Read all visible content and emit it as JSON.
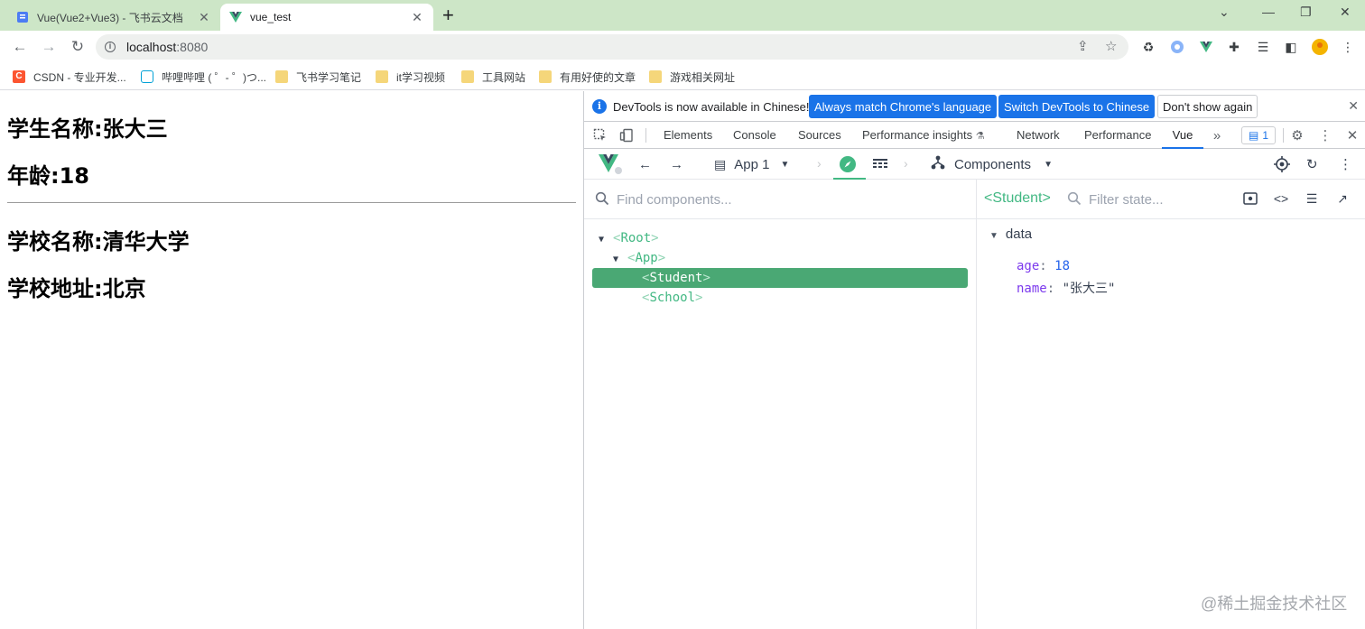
{
  "browser": {
    "tabs": [
      {
        "title": "Vue(Vue2+Vue3) - 飞书云文档",
        "icon": "doc-icon",
        "active": false
      },
      {
        "title": "vue_test",
        "icon": "vue-logo-icon",
        "active": true
      }
    ],
    "address": {
      "host": "localhost",
      "port": ":8080"
    },
    "bookmarks": [
      {
        "label": "CSDN - 专业开发...",
        "icon": "csdn-icon"
      },
      {
        "label": "哔哩哔哩 ( ゜- ゜)つ...",
        "icon": "bilibili-icon"
      },
      {
        "label": "飞书学习笔记",
        "icon": "folder-icon"
      },
      {
        "label": "it学习视频",
        "icon": "folder-icon"
      },
      {
        "label": "工具网站",
        "icon": "folder-icon"
      },
      {
        "label": "有用好使的文章",
        "icon": "folder-icon"
      },
      {
        "label": "游戏相关网址",
        "icon": "folder-icon"
      }
    ]
  },
  "page": {
    "student_name": "学生名称:张大三",
    "student_age": "年龄:18",
    "school_name": "学校名称:清华大学",
    "school_address": "学校地址:北京"
  },
  "devtools": {
    "infobar": {
      "message": "DevTools is now available in Chinese!",
      "match_button": "Always match Chrome's language",
      "switch_button": "Switch DevTools to Chinese",
      "dismiss_button": "Don't show again"
    },
    "tabs": [
      "Elements",
      "Console",
      "Sources",
      "Performance insights",
      "Network",
      "Performance",
      "Vue"
    ],
    "active_tab": "Vue",
    "issues_count": "1"
  },
  "vue": {
    "app_selector": "App 1",
    "view_selector": "Components",
    "find_placeholder": "Find components...",
    "filter_placeholder": "Filter state...",
    "selected_component": "<Student>",
    "tree": [
      {
        "name": "Root",
        "depth": 0,
        "expanded": true,
        "selected": false
      },
      {
        "name": "App",
        "depth": 1,
        "expanded": true,
        "selected": false
      },
      {
        "name": "Student",
        "depth": 2,
        "expanded": false,
        "selected": true
      },
      {
        "name": "School",
        "depth": 2,
        "expanded": false,
        "selected": false
      }
    ],
    "state": {
      "section": "data",
      "rows": [
        {
          "key": "age",
          "value": "18"
        },
        {
          "key": "name",
          "value": "\"张大三\""
        }
      ]
    }
  },
  "watermark": "@稀土掘金技术社区",
  "colors": {
    "tab_strip": "#cde6c7",
    "vue_green": "#42b883",
    "selected_row": "#4aa874",
    "chrome_blue": "#1a73e8"
  }
}
